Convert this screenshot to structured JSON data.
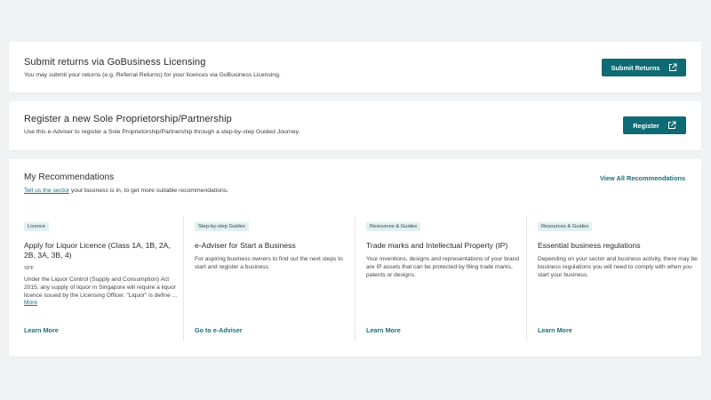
{
  "returns": {
    "title": "Submit returns via GoBusiness Licensing",
    "description": "You may submit your returns (e.g. Referral Returns) for your licences via GoBusiness Licensing.",
    "button_label": "Submit Returns"
  },
  "register": {
    "title": "Register a new Sole Proprietorship/Partnership",
    "description": "Use this e-Adviser to register a Sole Proprietorship/Partnership through a step-by-step Guided Journey.",
    "button_label": "Register"
  },
  "recommendations": {
    "title": "My Recommendations",
    "tell_us_link": "Tell us the sector",
    "tell_us_rest": " your business is in, to get more suitable recommendations.",
    "view_all_label": "View All Recommendations",
    "cards": [
      {
        "tag": "Licence",
        "title": "Apply for Liquor Licence (Class 1A, 1B, 2A, 2B, 3A, 3B, 4)",
        "meta": "SPF",
        "body": "Under the Liquor Control (Supply and Consumption) Act 2015, any supply of liquor in Singapore will require a liquor licence issued by the Licensing Officer. \"Liquor\" is define ...",
        "more_label": "More",
        "link_label": "Learn More"
      },
      {
        "tag": "Step-by-step Guides",
        "title": "e-Adviser for Start a Business",
        "body": "For aspiring business owners to find out the next steps to start and register a business.",
        "link_label": "Go to e-Adviser"
      },
      {
        "tag": "Resources & Guides",
        "title": "Trade marks and Intellectual Property (IP)",
        "body": "Your inventions, designs and representations of your brand are IP assets that can be protected by filing trade marks, patents or designs.",
        "link_label": "Learn More"
      },
      {
        "tag": "Resources & Guides",
        "title": "Essential business regulations",
        "body": "Depending on your sector and business activity, there may be business regulations you will need to comply with when you start your business.",
        "link_label": "Learn More"
      }
    ]
  },
  "colors": {
    "primary": "#0e6a73",
    "link": "#1d6f77",
    "tag_bg": "#e1efef",
    "page_bg": "#f1f2f3"
  }
}
